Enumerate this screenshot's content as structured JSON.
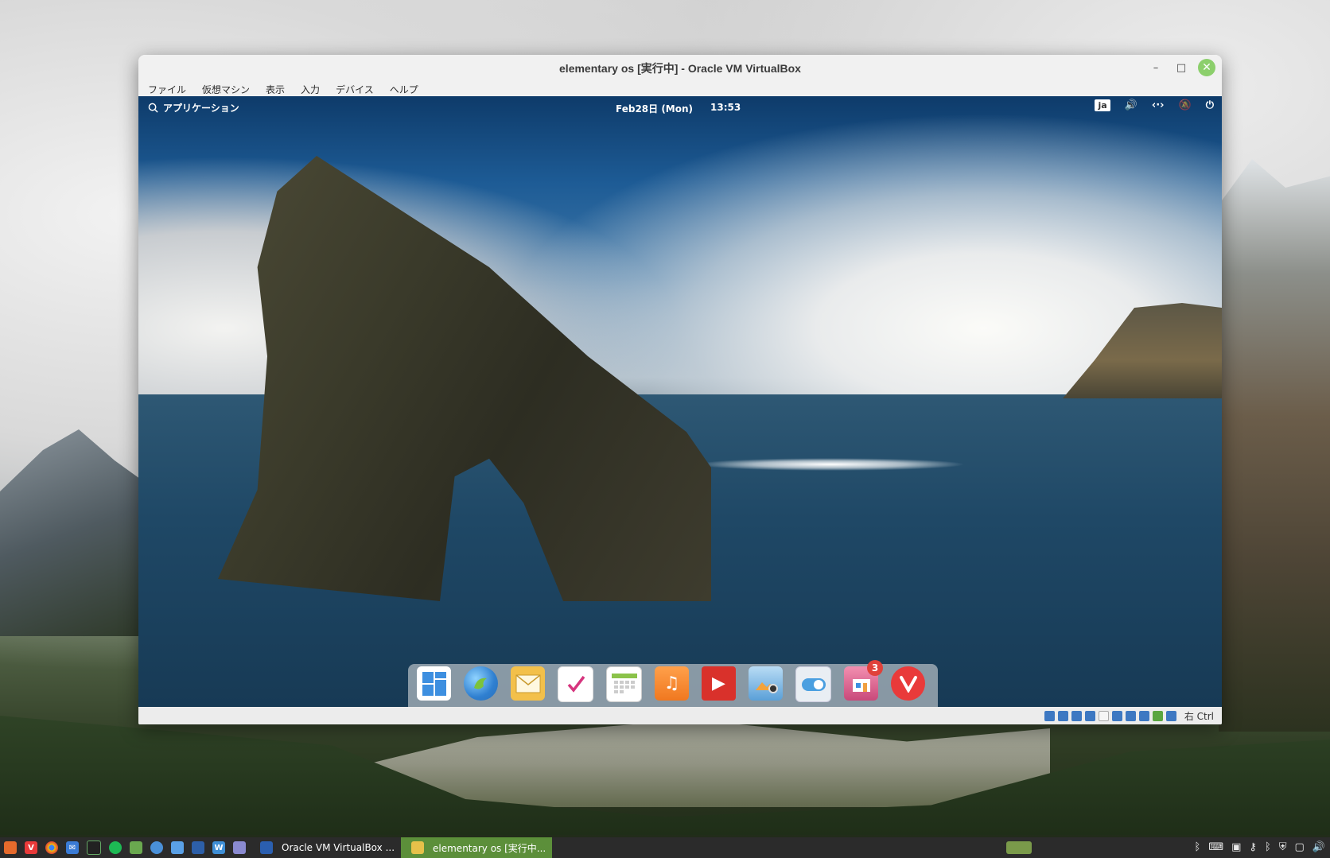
{
  "vbox": {
    "title": "elementary os [実行中] - Oracle VM VirtualBox",
    "menu": [
      "ファイル",
      "仮想マシン",
      "表示",
      "入力",
      "デバイス",
      "ヘルプ"
    ],
    "minimize": "–",
    "maximize": "□",
    "close": "✕",
    "status_hostkey": "右 Ctrl"
  },
  "guest": {
    "apps_label": "アプリケーション",
    "date": "Feb28日 (Mon)",
    "time": "13:53",
    "keyboard": "ja",
    "dock_badge": "3"
  },
  "taskbar": {
    "item1": "Oracle VM VirtualBox ...",
    "item2": "elementary os [実行中..."
  }
}
